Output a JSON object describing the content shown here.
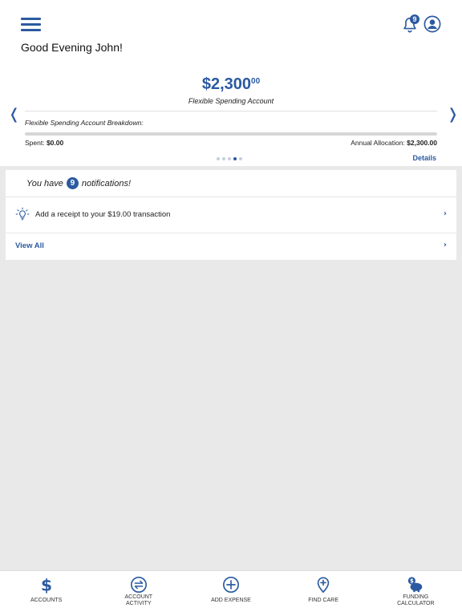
{
  "header": {
    "greeting": "Good Evening John!",
    "notification_count": "9"
  },
  "account_card": {
    "amount_main": "$2,300",
    "amount_cents": "00",
    "account_name": "Flexible Spending Account",
    "breakdown_label": "Flexible Spending Account Breakdown:",
    "spent_label": "Spent:",
    "spent_value": "$0.00",
    "annual_label": "Annual Allocation:",
    "annual_value": "$2,300.00",
    "spent_fraction": 0,
    "details_label": "Details",
    "carousel_total": 5,
    "carousel_active_index": 3
  },
  "notifications": {
    "prefix": "You have",
    "count": "9",
    "suffix": "notifications!",
    "items": [
      {
        "text": "Add a receipt to your $19.00 transaction",
        "icon": "lightbulb-icon"
      }
    ],
    "view_all_label": "View All"
  },
  "bottom_nav": {
    "items": [
      {
        "label": "ACCOUNTS",
        "icon": "dollar-icon"
      },
      {
        "label": "ACCOUNT ACTIVITY",
        "icon": "transfer-icon"
      },
      {
        "label": "ADD EXPENSE",
        "icon": "plus-circle-icon"
      },
      {
        "label": "FIND CARE",
        "icon": "map-pin-plus-icon"
      },
      {
        "label": "FUNDING CALCULATOR",
        "icon": "piggy-bank-icon"
      }
    ]
  },
  "colors": {
    "accent": "#2b5aa0",
    "background": "#e9e9e9"
  }
}
